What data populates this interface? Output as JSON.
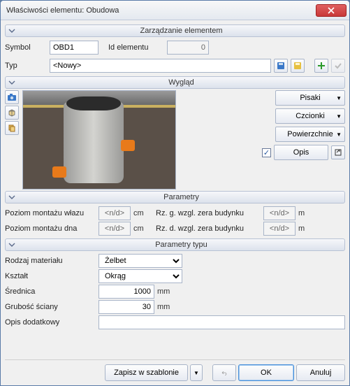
{
  "title": "Właściwości elementu: Obudowa",
  "sections": {
    "manage": "Zarządzanie elementem",
    "look": "Wygląd",
    "params": "Parametry",
    "type_params": "Parametry typu"
  },
  "manage": {
    "symbol_label": "Symbol",
    "symbol_value": "OBD1",
    "id_label": "Id elementu",
    "id_value": "0",
    "typ_label": "Typ",
    "typ_value": "<Nowy>"
  },
  "look": {
    "pisaki": "Pisaki",
    "czcionki": "Czcionki",
    "powierzchnie": "Powierzchnie",
    "opis": "Opis",
    "opis_checked": "✓"
  },
  "params": {
    "poziom_wlaz_label": "Poziom montażu włazu",
    "poziom_wlaz_value": "<n/d>",
    "poziom_dna_label": "Poziom montażu dna",
    "poziom_dna_value": "<n/d>",
    "rz_g_label": "Rz. g. wzgl. zera budynku",
    "rz_g_value": "<n/d>",
    "rz_d_label": "Rz. d. wzgl. zera budynku",
    "rz_d_value": "<n/d>",
    "unit_cm": "cm",
    "unit_m": "m"
  },
  "type_params": {
    "material_label": "Rodzaj materiału",
    "material_value": "Żelbet",
    "ksztalt_label": "Kształt",
    "ksztalt_value": "Okrąg",
    "srednica_label": "Średnica",
    "srednica_value": "1000",
    "grubosc_label": "Grubość ściany",
    "grubosc_value": "30",
    "opis_dod_label": "Opis dodatkowy",
    "opis_dod_value": "",
    "unit_mm": "mm"
  },
  "footer": {
    "save_tpl": "Zapisz w szablonie",
    "ok": "OK",
    "cancel": "Anuluj"
  }
}
